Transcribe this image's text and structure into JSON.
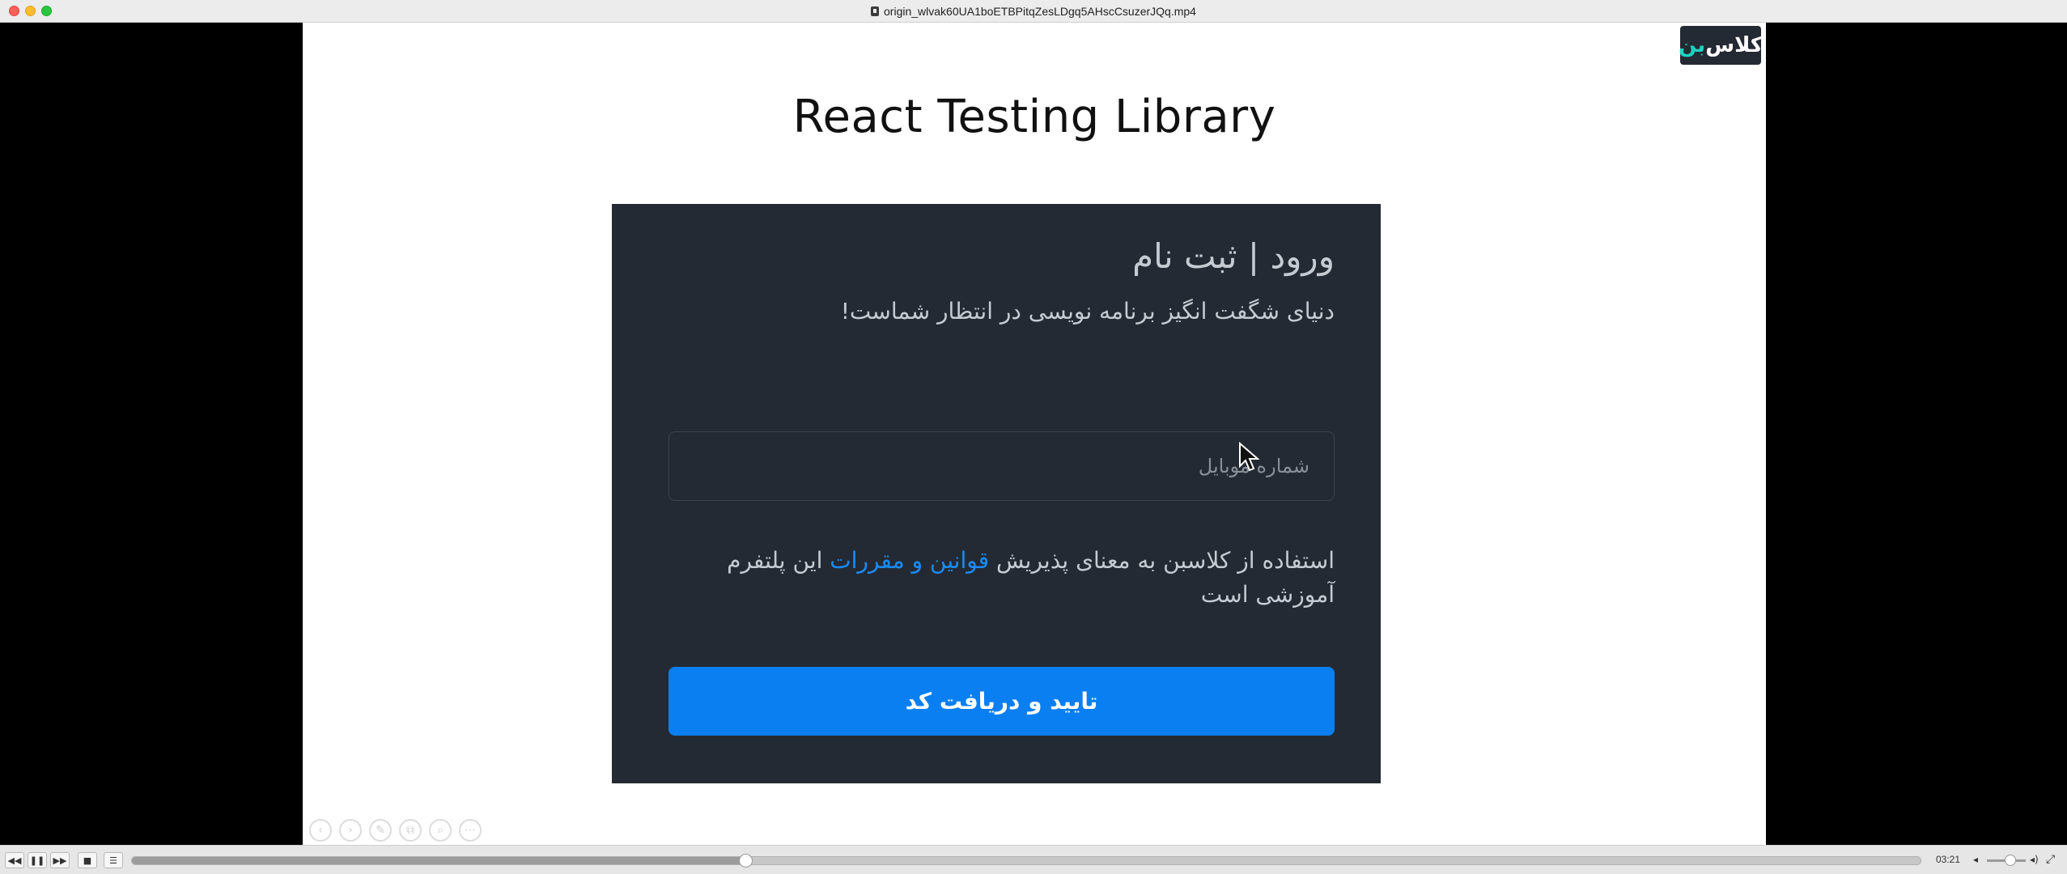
{
  "window": {
    "title": "origin_wlvak60UA1boETBPitqZesLDgq5AHscCsuzerJQq.mp4"
  },
  "slide": {
    "title": "React Testing Library",
    "logo": {
      "text_main": "کلاس",
      "text_accent": "بن"
    }
  },
  "card": {
    "heading": "ورود | ثبت نام",
    "subtitle": "دنیای شگفت انگیز برنامه نویسی در انتظار شماست!",
    "phone_placeholder": "شماره موبایل",
    "terms_before": "استفاده از کلاسبن به معنای پذیریش ",
    "terms_link": "قوانین و مقررات",
    "terms_after": " این پلتفرم آموزشی است",
    "submit_label": "تایید و دریافت کد",
    "colors": {
      "background": "#242a33",
      "button": "#0a7ff2",
      "link": "#1a8cff"
    }
  },
  "slide_tools": [
    {
      "icon": "prev-slide-icon",
      "glyph": "‹"
    },
    {
      "icon": "next-slide-icon",
      "glyph": "›"
    },
    {
      "icon": "pen-icon",
      "glyph": "✎"
    },
    {
      "icon": "copy-icon",
      "glyph": "⧉"
    },
    {
      "icon": "zoom-icon",
      "glyph": "⌕"
    },
    {
      "icon": "more-icon",
      "glyph": "⋯"
    }
  ],
  "player": {
    "time": "03:21",
    "progress": 0.343,
    "volume": 0.6,
    "buttons": {
      "rewind": "◀◀",
      "pause": "❚❚",
      "forward": "▶▶",
      "stop": "■",
      "playlist": "☰",
      "vol_low": "◂",
      "vol_high": "◂)",
      "fullscreen": "⤢"
    }
  }
}
